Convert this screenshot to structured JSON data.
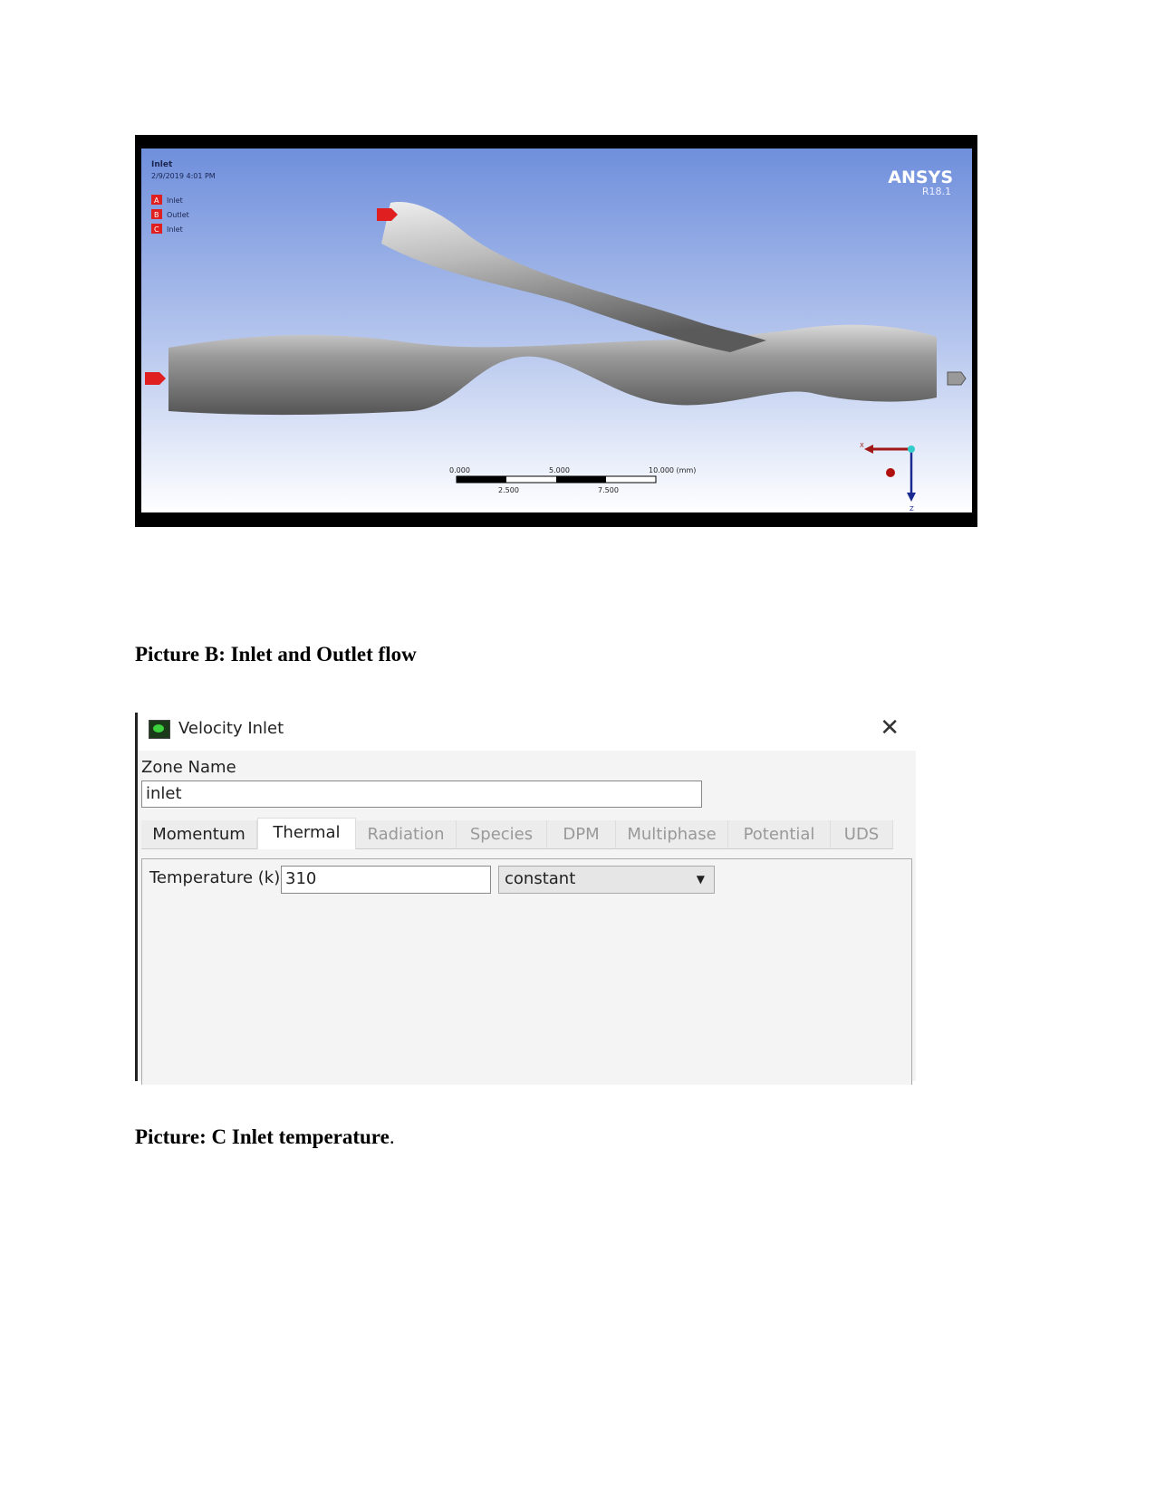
{
  "figure_b": {
    "viewer_title": "Inlet",
    "viewer_timestamp": "2/9/2019 4:01 PM",
    "legend": [
      {
        "tag": "A",
        "label": "Inlet"
      },
      {
        "tag": "B",
        "label": "Outlet"
      },
      {
        "tag": "C",
        "label": "Inlet"
      }
    ],
    "brand": "ANSYS",
    "version": "R18.1",
    "scale_top_labels": [
      "0.000",
      "5.000",
      "10.000 (mm)"
    ],
    "scale_bottom_labels": [
      "2.500",
      "7.500"
    ],
    "axis_labels": {
      "x": "X",
      "z": "Z"
    },
    "colors": {
      "background_top": "#6f8fdc",
      "background_bottom": "#ffffff",
      "marker": "#e02020"
    }
  },
  "caption_b": "Picture B: Inlet and Outlet flow",
  "dialog": {
    "title": "Velocity Inlet",
    "close_icon": "close-icon",
    "zone_name_label": "Zone Name",
    "zone_name_value": "inlet",
    "tabs": [
      {
        "label": "Momentum",
        "state": "enabled"
      },
      {
        "label": "Thermal",
        "state": "active"
      },
      {
        "label": "Radiation",
        "state": "disabled"
      },
      {
        "label": "Species",
        "state": "disabled"
      },
      {
        "label": "DPM",
        "state": "disabled"
      },
      {
        "label": "Multiphase",
        "state": "disabled"
      },
      {
        "label": "Potential",
        "state": "disabled"
      },
      {
        "label": "UDS",
        "state": "disabled"
      }
    ],
    "temperature_label": "Temperature (k)",
    "temperature_value": "310",
    "temperature_method": "constant"
  },
  "caption_c": "Picture: C Inlet temperature",
  "caption_c_suffix": "."
}
